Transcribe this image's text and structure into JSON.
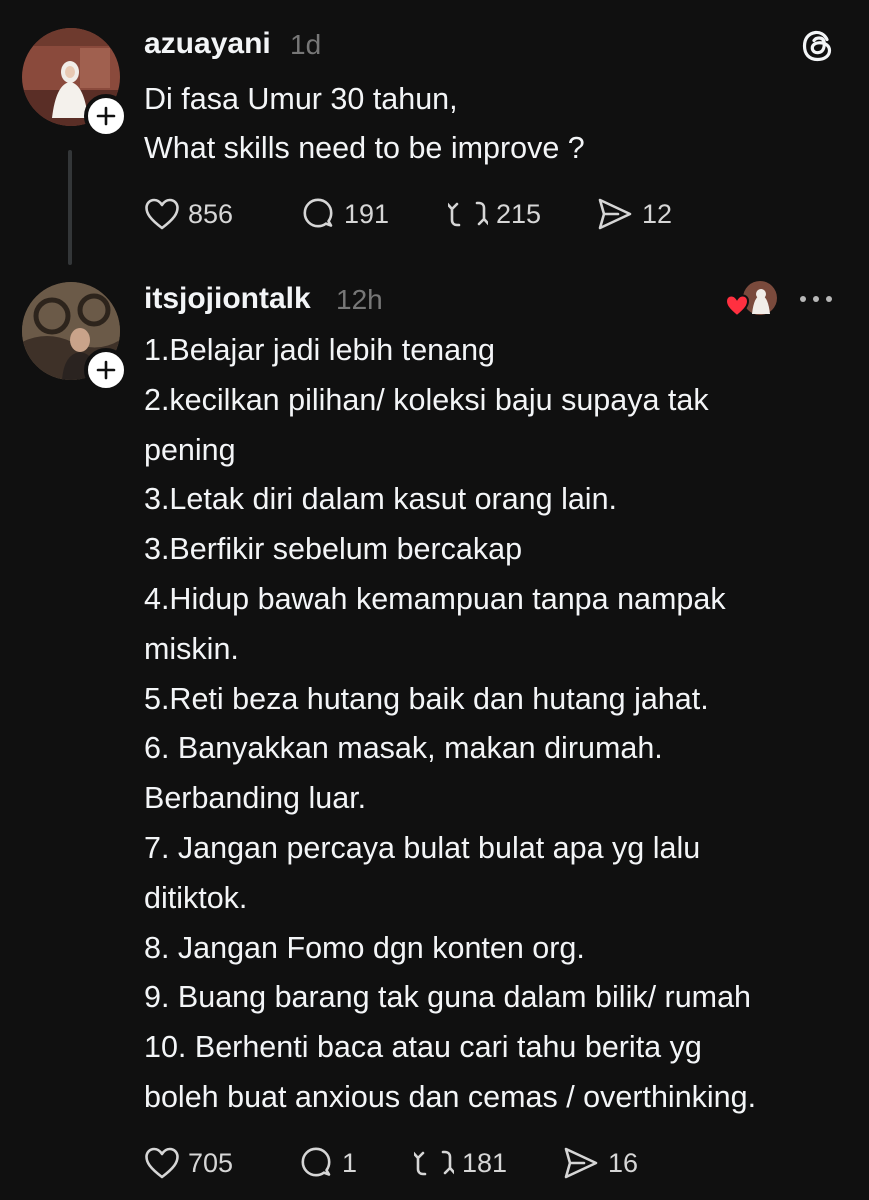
{
  "app": {
    "logo_icon": "threads-logo-icon"
  },
  "post": {
    "username": "azuayani",
    "time": "1d",
    "lines": [
      "Di fasa Umur 30 tahun,",
      "What skills need to be improve ?"
    ],
    "actions": {
      "likes": "856",
      "replies": "191",
      "reposts": "215",
      "shares": "12"
    }
  },
  "reply": {
    "username": "itsjojiontalk",
    "time": "12h",
    "liked_by_author_icon": "heart-avatar-icon",
    "more_icon": "more-icon",
    "lines": [
      "1.Belajar jadi lebih tenang",
      "2.kecilkan pilihan/ koleksi baju supaya tak",
      "pening",
      "3.Letak diri dalam kasut orang lain.",
      "3.Berfikir sebelum bercakap",
      "4.Hidup bawah kemampuan tanpa nampak",
      "miskin.",
      "5.Reti beza hutang baik dan hutang jahat.",
      "6. Banyakkan masak, makan dirumah.",
      "Berbanding luar.",
      "7. Jangan percaya bulat bulat apa  yg lalu",
      "ditiktok.",
      "8. Jangan Fomo dgn konten org.",
      "9. Buang barang tak guna dalam bilik/ rumah",
      "10. Berhenti baca atau cari tahu berita yg",
      "boleh buat anxious dan cemas / overthinking."
    ],
    "actions": {
      "likes": "705",
      "replies": "1",
      "reposts": "181",
      "shares": "16"
    }
  },
  "colors": {
    "background": "#101010",
    "text": "#f3f5f7",
    "muted": "#777777",
    "heart": "#ff3040"
  }
}
